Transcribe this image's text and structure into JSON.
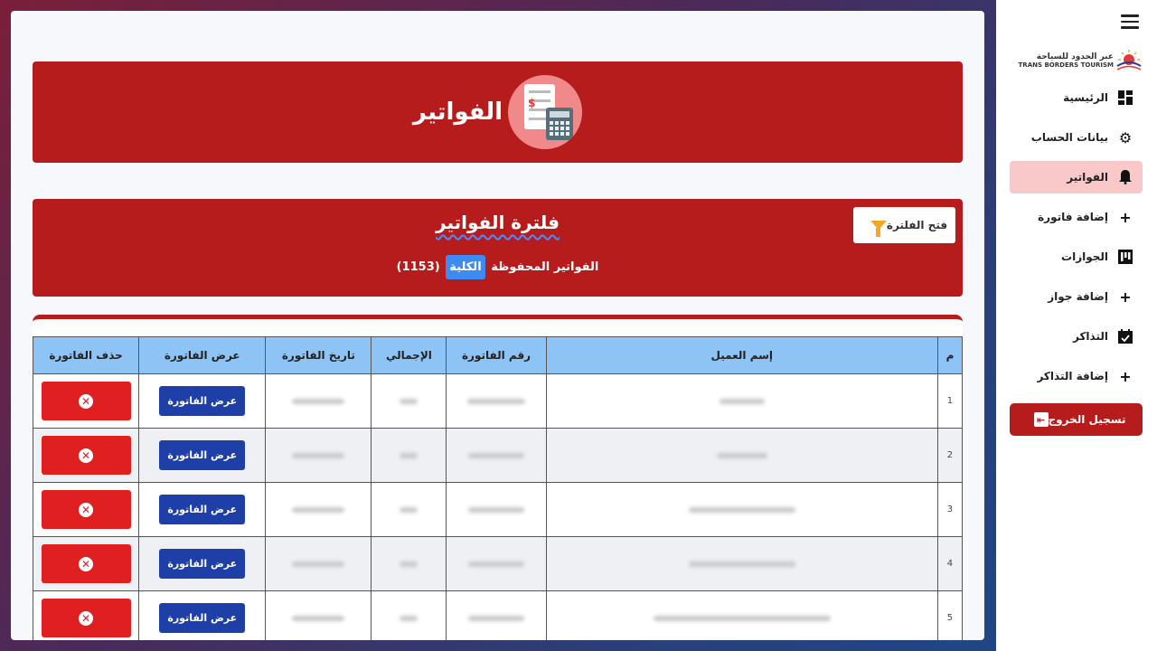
{
  "sidebar": {
    "logo": {
      "arabic": "عبر الحدود للسياحة",
      "english": "TRANS BORDERS TOURISM"
    },
    "items": [
      {
        "label": "الرئيسية",
        "icon": "dashboard-icon"
      },
      {
        "label": "بيانات الحساب",
        "icon": "gear-icon"
      },
      {
        "label": "الفواتير",
        "icon": "bell-icon",
        "active": true
      },
      {
        "label": "إضافة فاتورة",
        "icon": "plus-icon"
      },
      {
        "label": "الجوازات",
        "icon": "board-icon"
      },
      {
        "label": "إضافة جواز",
        "icon": "plus-icon"
      },
      {
        "label": "التذاكر",
        "icon": "calendar-check-icon"
      },
      {
        "label": "إضافة التذاكر",
        "icon": "plus-icon"
      }
    ],
    "logout_label": "تسجيل الخروج"
  },
  "banner": {
    "title": "الفواتير"
  },
  "filter": {
    "title": "فلترة الفواتير",
    "open_label": "فتح الفلترة",
    "count_prefix": "الفواتير المحفوظة",
    "count_badge": "الكلية",
    "count_value": "(1153)"
  },
  "table": {
    "headers": [
      "م",
      "إسم العميل",
      "رقم الفاتورة",
      "الإجمالي",
      "تاريخ الفاتورة",
      "عرض الفاتورة",
      "حذف الفاتورة"
    ],
    "rows": [
      {
        "n": "1",
        "view": "عرض الفاتورة"
      },
      {
        "n": "2",
        "view": "عرض الفاتورة"
      },
      {
        "n": "3",
        "view": "عرض الفاتورة"
      },
      {
        "n": "4",
        "view": "عرض الفاتورة"
      },
      {
        "n": "5",
        "view": "عرض الفاتورة"
      }
    ]
  },
  "colors": {
    "brand_red": "#b71c1c",
    "header_blue": "#8ec3f5",
    "view_blue": "#1e3fa8",
    "delete_red": "#e02020"
  }
}
